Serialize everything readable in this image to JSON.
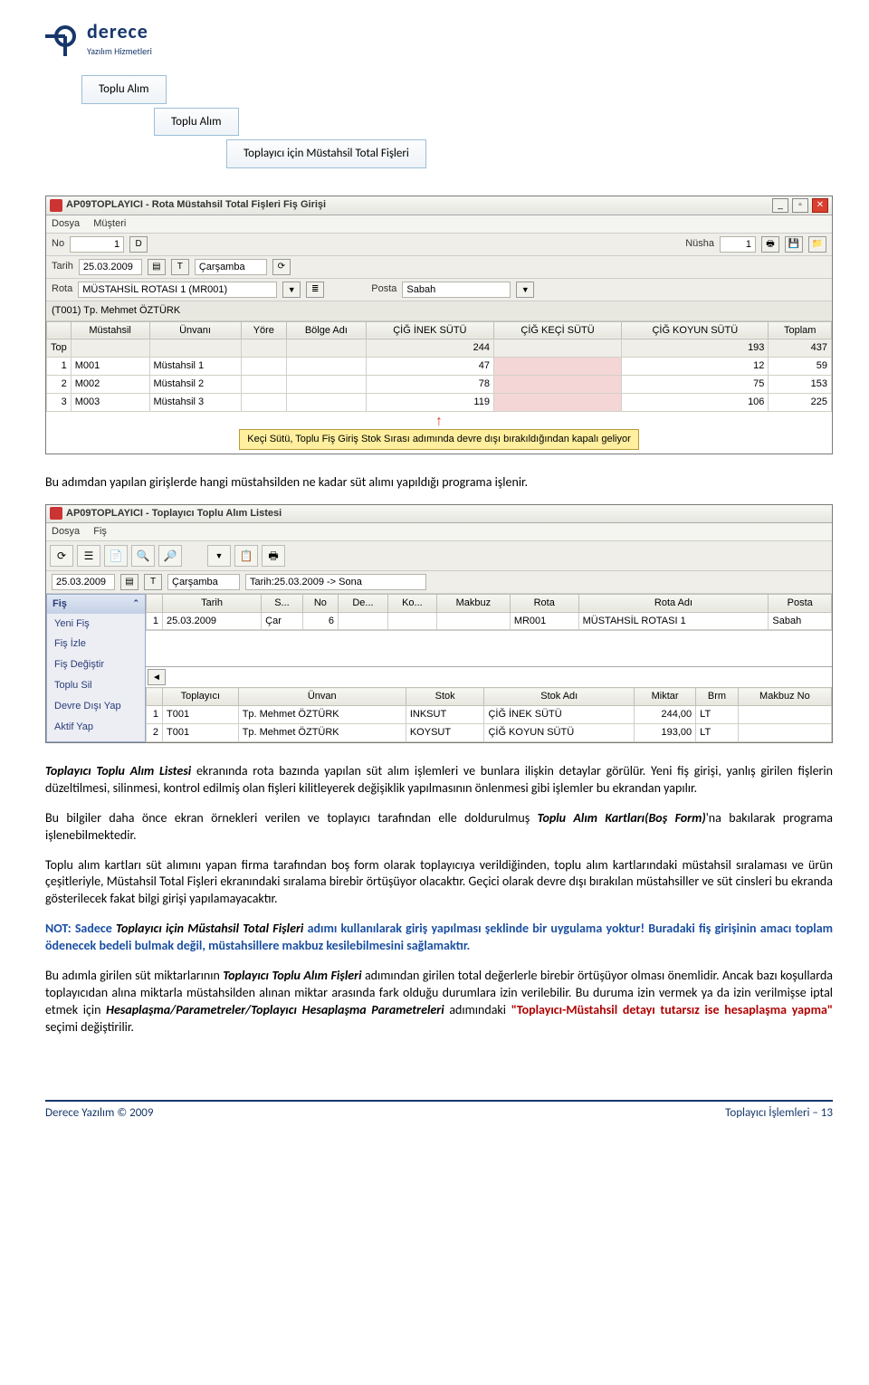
{
  "logo": {
    "brand": "derece",
    "tagline": "Yazılım Hizmetleri"
  },
  "breadcrumb": {
    "l1": "Toplu Alım",
    "l2": "Toplu Alım",
    "l3": "Toplayıcı için Müstahsil Total Fişleri"
  },
  "win1": {
    "title": "AP09TOPLAYICI - Rota Müstahsil Total Fişleri Fiş Girişi",
    "menu_dosya": "Dosya",
    "menu_musteri": "Müşteri",
    "lbl_no": "No",
    "val_no": "1",
    "btn_d": "D",
    "lbl_tarih": "Tarih",
    "val_tarih": "25.03.2009",
    "btn_t": "T",
    "val_gun": "Çarşamba",
    "lbl_nusha": "Nüsha",
    "val_nusha": "1",
    "lbl_rota": "Rota",
    "val_rota": "MÜSTAHSİL ROTASI 1 (MR001)",
    "lbl_posta": "Posta",
    "val_posta": "Sabah",
    "subtitle": "(T001) Tp. Mehmet ÖZTÜRK",
    "cols": {
      "mustahsil": "Müstahsil",
      "unvani": "Ünvanı",
      "yore": "Yöre",
      "bolge": "Bölge Adı",
      "inek": "ÇİĞ İNEK SÜTÜ",
      "keci": "ÇİĞ KEÇİ SÜTÜ",
      "koyun": "ÇİĞ KOYUN SÜTÜ",
      "toplam": "Toplam"
    },
    "top_label": "Top",
    "top_inek": "244",
    "top_koyun": "193",
    "top_toplam": "437",
    "rows": [
      {
        "n": "1",
        "kod": "M001",
        "unvan": "Müstahsil 1",
        "inek": "47",
        "koyun": "12",
        "toplam": "59"
      },
      {
        "n": "2",
        "kod": "M002",
        "unvan": "Müstahsil 2",
        "inek": "78",
        "koyun": "75",
        "toplam": "153"
      },
      {
        "n": "3",
        "kod": "M003",
        "unvan": "Müstahsil 3",
        "inek": "119",
        "koyun": "106",
        "toplam": "225"
      }
    ],
    "callout": "Keçi Sütü, Toplu Fiş Giriş Stok Sırası adımında devre dışı bırakıldığından kapalı geliyor"
  },
  "p1": "Bu adımdan yapılan girişlerde hangi müstahsilden ne kadar süt alımı yapıldığı programa işlenir.",
  "win2": {
    "title": "AP09TOPLAYICI - Toplayıcı Toplu Alım Listesi",
    "menu_dosya": "Dosya",
    "menu_fis": "Fiş",
    "val_tarih": "25.03.2009",
    "val_gun": "Çarşamba",
    "val_range": "Tarih:25.03.2009 -> Sona",
    "side_head": "Fiş",
    "side_items": [
      "Yeni Fiş",
      "Fiş İzle",
      "Fiş Değiştir",
      "Toplu Sil",
      "Devre Dışı Yap",
      "Aktif Yap"
    ],
    "cols1": {
      "tarih": "Tarih",
      "s": "S...",
      "no": "No",
      "de": "De...",
      "ko": "Ko...",
      "makbuz": "Makbuz",
      "rota": "Rota",
      "rotaadi": "Rota Adı",
      "posta": "Posta"
    },
    "row1": {
      "n": "1",
      "tarih": "25.03.2009",
      "s": "Çar",
      "no": "6",
      "rota": "MR001",
      "rotaadi": "MÜSTAHSİL ROTASI 1",
      "posta": "Sabah"
    },
    "cols2": {
      "toplayici": "Toplayıcı",
      "unvan": "Ünvan",
      "stok": "Stok",
      "stokadi": "Stok Adı",
      "miktar": "Miktar",
      "brm": "Brm",
      "makbuzno": "Makbuz No"
    },
    "rows2": [
      {
        "n": "1",
        "top": "T001",
        "unvan": "Tp. Mehmet ÖZTÜRK",
        "stok": "INKSUT",
        "stokadi": "ÇİĞ İNEK SÜTÜ",
        "miktar": "244,00",
        "brm": "LT"
      },
      {
        "n": "2",
        "top": "T001",
        "unvan": "Tp. Mehmet ÖZTÜRK",
        "stok": "KOYSUT",
        "stokadi": "ÇİĞ KOYUN SÜTÜ",
        "miktar": "193,00",
        "brm": "LT"
      }
    ]
  },
  "p2_pre": "Toplayıcı Toplu Alım Listesi",
  "p2_post": " ekranında rota bazında yapılan süt alım işlemleri ve bunlara ilişkin detaylar görülür. Yeni fiş girişi, yanlış girilen fişlerin düzeltilmesi, silinmesi, kontrol edilmiş olan fişleri kilitleyerek değişiklik yapılmasının önlenmesi gibi işlemler bu ekrandan yapılır.",
  "p3_a": "Bu bilgiler daha önce ekran örnekleri verilen ve toplayıcı tarafından elle doldurulmuş ",
  "p3_b": "Toplu Alım Kartları(Boş Form)",
  "p3_c": "'na bakılarak programa işlenebilmektedir.",
  "p4": "Toplu alım kartları süt alımını yapan firma tarafından boş form olarak toplayıcıya verildiğinden, toplu alım kartlarındaki müstahsil sıralaması ve ürün çeşitleriyle, Müstahsil Total Fişleri ekranındaki sıralama birebir örtüşüyor olacaktır. Geçici olarak devre dışı bırakılan müstahsiller ve süt cinsleri bu ekranda gösterilecek fakat bilgi girişi yapılamayacaktır.",
  "p5_a": "NOT: Sadece ",
  "p5_b": "Toplayıcı için Müstahsil Total Fişleri",
  "p5_c": " adımı kullanılarak giriş yapılması şeklinde bir uygulama yoktur! ",
  "p5_d": "  Buradaki fiş girişinin amacı toplam ödenecek bedeli bulmak değil, müstahsillere makbuz kesilebilmesini sağlamaktır.",
  "p6_a": "Bu adımla girilen süt miktarlarının ",
  "p6_b": "Toplayıcı Toplu Alım Fişleri",
  "p6_c": " adımından girilen total değerlerle birebir örtüşüyor olması önemlidir. Ancak bazı koşullarda toplayıcıdan alına miktarla müstahsilden alınan miktar arasında fark olduğu durumlara izin verilebilir. Bu duruma izin vermek ya da izin verilmişse iptal etmek için ",
  "p6_d": "Hesaplaşma/Parametreler/Toplayıcı Hesaplaşma Parametreleri",
  "p6_e": " adımındaki ",
  "p6_f": "\"Toplayıcı-Müstahsil detayı tutarsız ise hesaplaşma yapma\"",
  "p6_g": " seçimi değiştirilir.",
  "footer_left": "Derece Yazılım © 2009",
  "footer_right": "Toplayıcı İşlemleri – 13"
}
